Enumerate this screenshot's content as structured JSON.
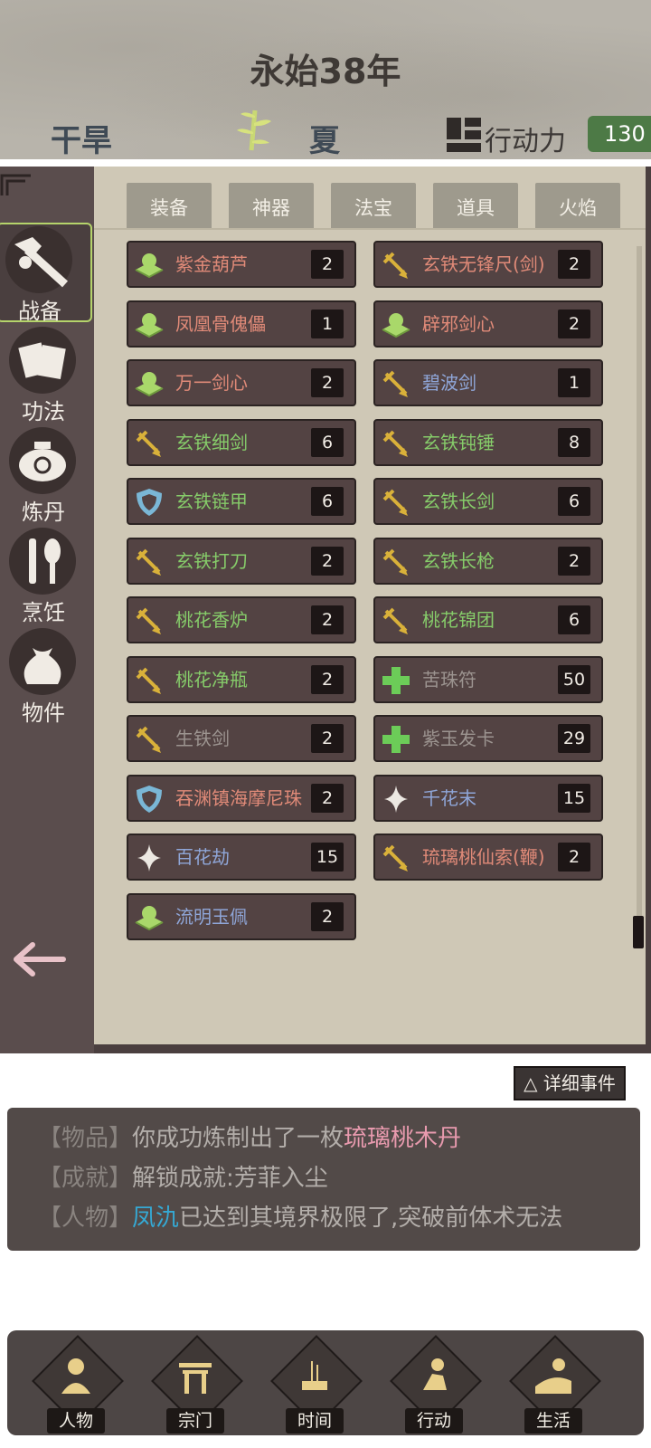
{
  "header": {
    "year": "永始38年",
    "weather": "干旱",
    "season": "夏",
    "ap_label": "行动力",
    "ap_value": "130"
  },
  "sidebar": {
    "items": [
      {
        "label": "战备",
        "icon": "sword-armor-icon",
        "active": true
      },
      {
        "label": "功法",
        "icon": "scroll-icon",
        "active": false
      },
      {
        "label": "炼丹",
        "icon": "cauldron-icon",
        "active": false
      },
      {
        "label": "烹饪",
        "icon": "cooking-icon",
        "active": false
      },
      {
        "label": "物件",
        "icon": "pouch-icon",
        "active": false
      }
    ],
    "active_color": "#b5d46b"
  },
  "tabs": [
    "装备",
    "神器",
    "法宝",
    "道具",
    "火焰"
  ],
  "items": [
    {
      "name": "紫金葫芦",
      "count": "2",
      "icon": "jade-artifact-icon",
      "color": "#e08a78"
    },
    {
      "name": "玄铁无锋尺(剑)",
      "count": "2",
      "icon": "sword-icon",
      "color": "#e08a78"
    },
    {
      "name": "凤凰骨傀儡",
      "count": "1",
      "icon": "jade-artifact-icon",
      "color": "#e08a78"
    },
    {
      "name": "辟邪剑心",
      "count": "2",
      "icon": "jade-artifact-icon",
      "color": "#e08a78"
    },
    {
      "name": "万一剑心",
      "count": "2",
      "icon": "jade-artifact-icon",
      "color": "#e08a78"
    },
    {
      "name": "碧波剑",
      "count": "1",
      "icon": "sword-icon",
      "color": "#8fa6d8"
    },
    {
      "name": "玄铁细剑",
      "count": "6",
      "icon": "sword-icon",
      "color": "#86cc6a"
    },
    {
      "name": "玄铁钝锤",
      "count": "8",
      "icon": "sword-icon",
      "color": "#86cc6a"
    },
    {
      "name": "玄铁链甲",
      "count": "6",
      "icon": "shield-icon",
      "color": "#86cc6a"
    },
    {
      "name": "玄铁长剑",
      "count": "6",
      "icon": "sword-icon",
      "color": "#86cc6a"
    },
    {
      "name": "玄铁打刀",
      "count": "2",
      "icon": "sword-icon",
      "color": "#86cc6a"
    },
    {
      "name": "玄铁长枪",
      "count": "2",
      "icon": "sword-icon",
      "color": "#86cc6a"
    },
    {
      "name": "桃花香炉",
      "count": "2",
      "icon": "sword-icon",
      "color": "#86cc6a"
    },
    {
      "name": "桃花锦团",
      "count": "6",
      "icon": "sword-icon",
      "color": "#86cc6a"
    },
    {
      "name": "桃花净瓶",
      "count": "2",
      "icon": "sword-icon",
      "color": "#86cc6a"
    },
    {
      "name": "苦珠符",
      "count": "50",
      "icon": "cross-icon",
      "color": "#9c9490"
    },
    {
      "name": "生铁剑",
      "count": "2",
      "icon": "sword-icon",
      "color": "#9c9490"
    },
    {
      "name": "紫玉发卡",
      "count": "29",
      "icon": "cross-icon",
      "color": "#9c9490"
    },
    {
      "name": "吞渊镇海摩尼珠",
      "count": "2",
      "icon": "shield-icon",
      "color": "#e08a78"
    },
    {
      "name": "千花末",
      "count": "15",
      "icon": "sparkle-icon",
      "color": "#8fa6d8"
    },
    {
      "name": "百花劫",
      "count": "15",
      "icon": "sparkle-icon",
      "color": "#8fa6d8"
    },
    {
      "name": "琉璃桃仙索(鞭)",
      "count": "2",
      "icon": "sword-icon",
      "color": "#e08a78"
    },
    {
      "name": "流明玉佩",
      "count": "2",
      "icon": "jade-artifact-icon",
      "color": "#8fa6d8"
    }
  ],
  "detail_button": "△ 详细事件",
  "events": [
    {
      "category": "【物品】",
      "text": "你成功炼制出了一枚",
      "highlight": "琉璃桃木丹",
      "highlight_color": "#e89aae",
      "rest": ""
    },
    {
      "category": "【成就】",
      "text": "解锁成就:芳菲入尘",
      "highlight": "",
      "highlight_color": "",
      "rest": ""
    },
    {
      "category": "【人物】",
      "text": "",
      "highlight": "凤氿",
      "highlight_color": "#35a9d4",
      "rest": "已达到其境界极限了,突破前体术无法"
    }
  ],
  "nav": [
    {
      "label": "人物",
      "icon": "person-icon"
    },
    {
      "label": "宗门",
      "icon": "gate-icon"
    },
    {
      "label": "时间",
      "icon": "incense-icon"
    },
    {
      "label": "行动",
      "icon": "action-icon"
    },
    {
      "label": "生活",
      "icon": "landscape-icon"
    }
  ],
  "colors": {
    "ap_badge": "#4d7a46",
    "jade": "#a9d86a",
    "sword": "#d9b13a",
    "shield": "#7ab7d6",
    "cross": "#6ccc58"
  }
}
